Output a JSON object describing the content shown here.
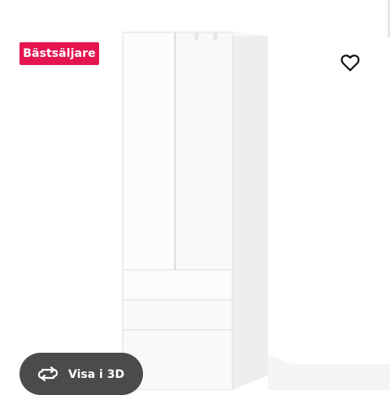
{
  "badge": {
    "label": "Bästsäljare",
    "color": "#e4154f"
  },
  "favorite": {
    "icon": "heart-outline-icon"
  },
  "view3d": {
    "label": "Visa i 3D",
    "icon": "rotate-3d-icon",
    "background": "#4b4b4b"
  },
  "product_image": {
    "subject": "white wardrobe",
    "background": "#ffffff"
  }
}
